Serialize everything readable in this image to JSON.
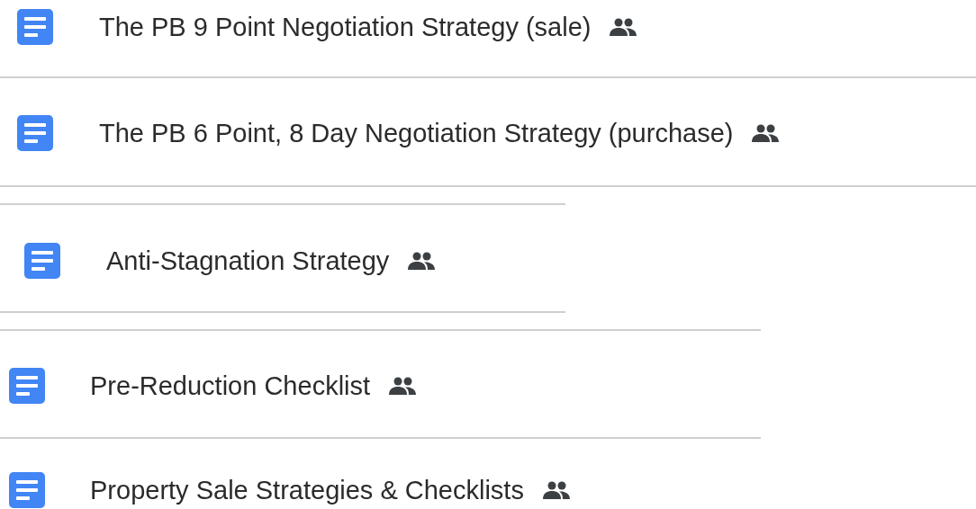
{
  "files": [
    {
      "name": "The PB 9 Point Negotiation Strategy (sale)",
      "shared": true
    },
    {
      "name": "The PB 6 Point, 8 Day Negotiation Strategy (purchase)",
      "shared": true
    },
    {
      "name": "Anti-Stagnation Strategy",
      "shared": true
    },
    {
      "name": "Pre-Reduction Checklist",
      "shared": true
    },
    {
      "name": "Property Sale Strategies & Checklists",
      "shared": true
    }
  ]
}
